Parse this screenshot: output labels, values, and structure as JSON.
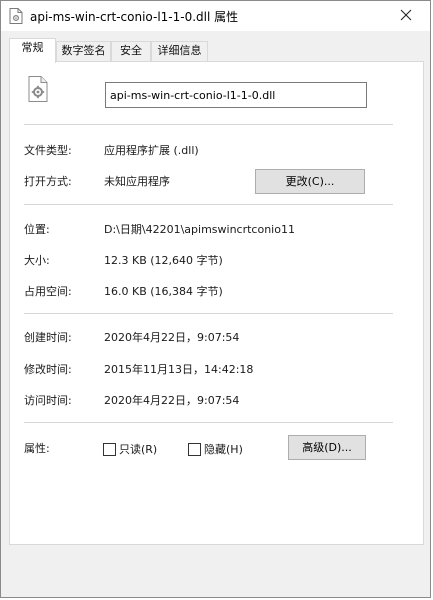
{
  "window": {
    "title": "api-ms-win-crt-conio-l1-1-0.dll 属性",
    "title_icon": "dll-file-icon",
    "close_icon": "close-icon"
  },
  "tabs": [
    {
      "label": "常规",
      "active": true
    },
    {
      "label": "数字签名",
      "active": false
    },
    {
      "label": "安全",
      "active": false
    },
    {
      "label": "详细信息",
      "active": false
    }
  ],
  "general": {
    "file_icon": "dll-gear-file-icon",
    "file_name": "api-ms-win-crt-conio-l1-1-0.dll",
    "file_type": {
      "label": "文件类型:",
      "value": "应用程序扩展 (.dll)"
    },
    "open_with": {
      "label": "打开方式:",
      "value": "未知应用程序",
      "button": "更改(C)..."
    },
    "location": {
      "label": "位置:",
      "value": "D:\\日期\\42201\\apimswincrtconio11"
    },
    "size": {
      "label": "大小:",
      "value": "12.3 KB (12,640 字节)"
    },
    "size_on_disk": {
      "label": "占用空间:",
      "value": "16.0 KB (16,384 字节)"
    },
    "created": {
      "label": "创建时间:",
      "value": "2020年4月22日，9:07:54"
    },
    "modified": {
      "label": "修改时间:",
      "value": "2015年11月13日，14:42:18"
    },
    "accessed": {
      "label": "访问时间:",
      "value": "2020年4月22日，9:07:54"
    },
    "attributes": {
      "label": "属性:",
      "readonly": {
        "label": "只读(R)",
        "checked": false
      },
      "hidden": {
        "label": "隐藏(H)",
        "checked": false
      },
      "advanced_button": "高级(D)..."
    }
  }
}
